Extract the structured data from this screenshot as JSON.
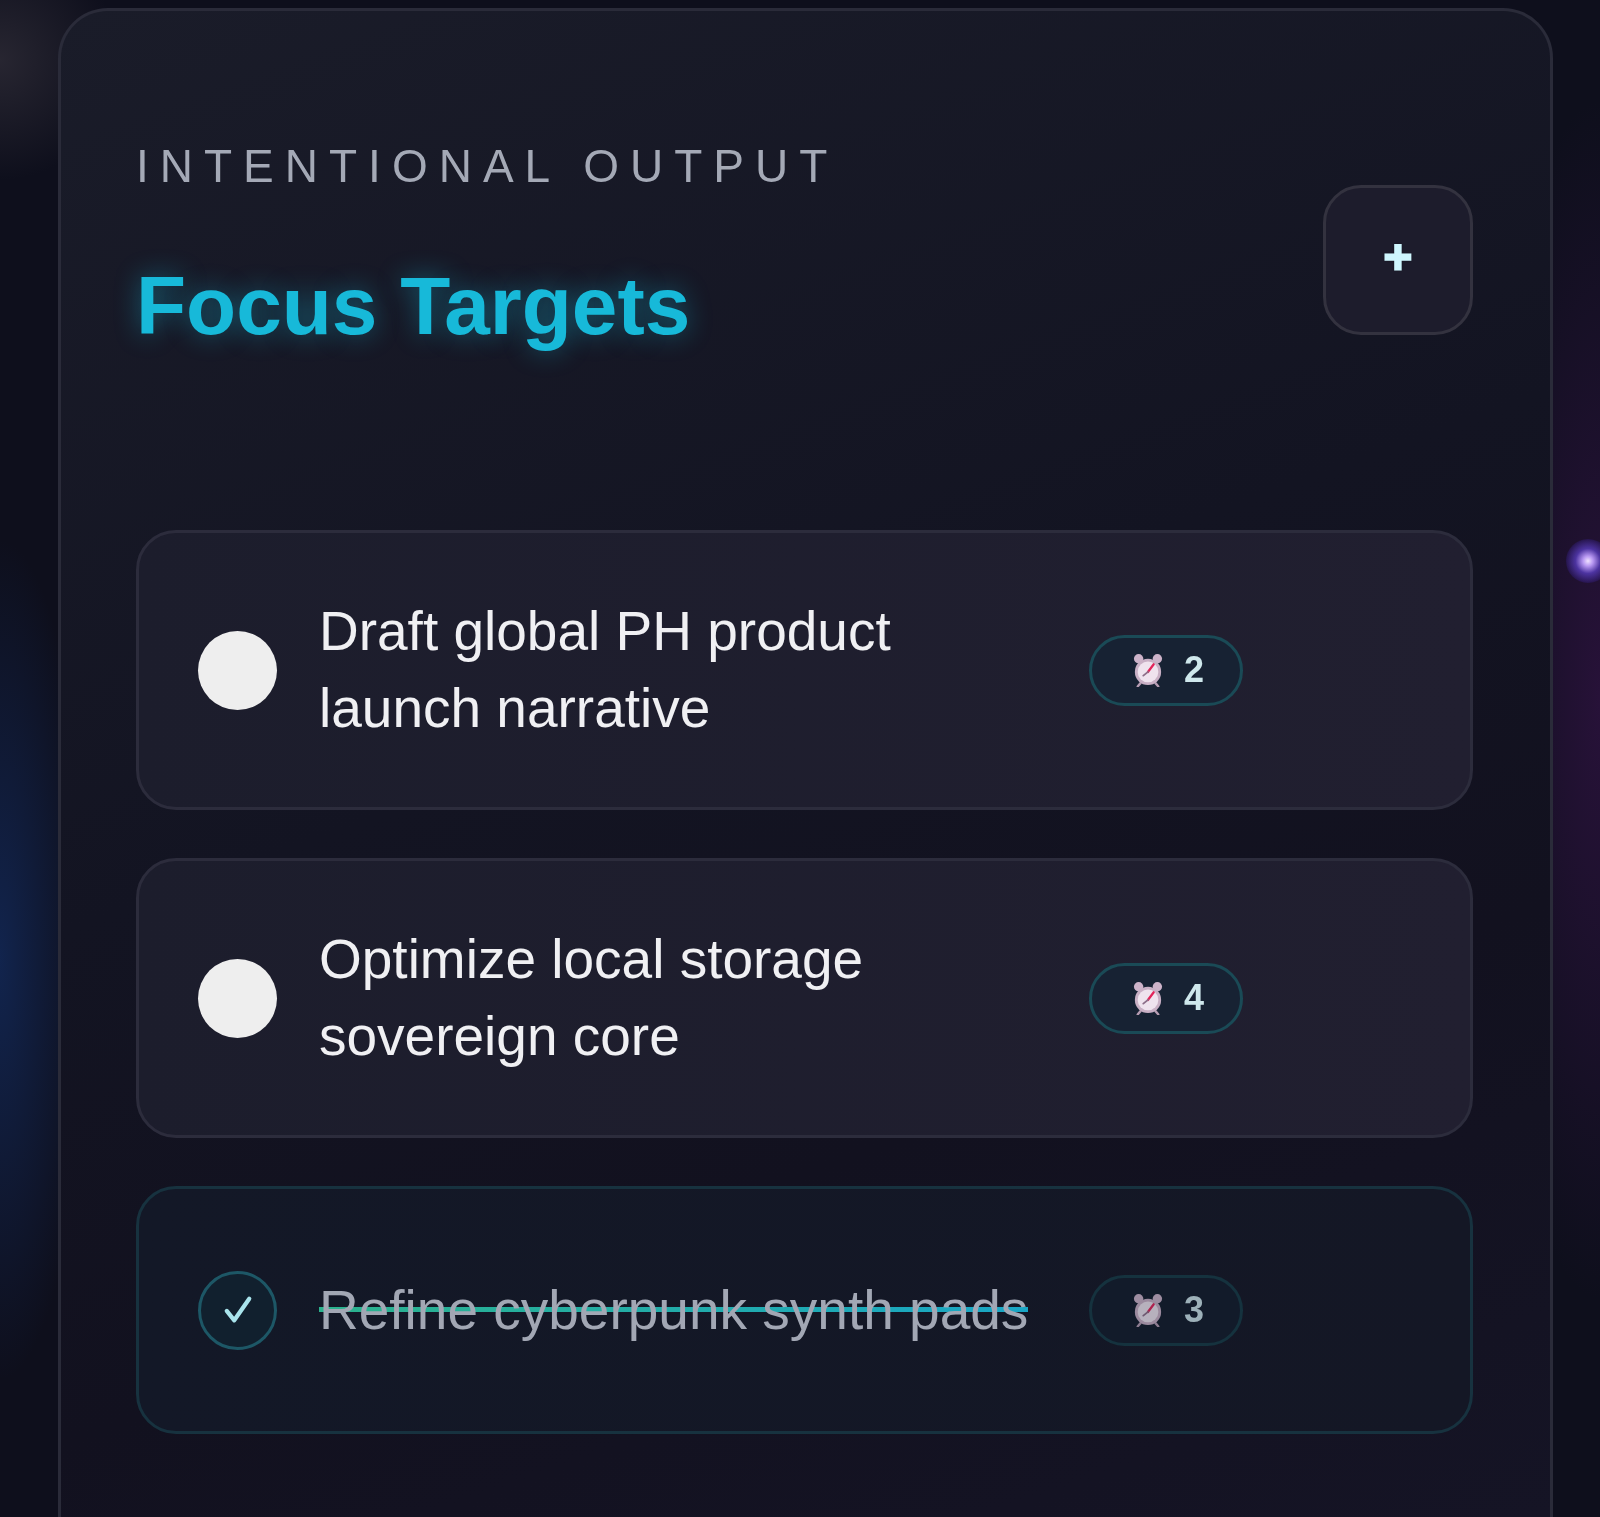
{
  "section_label": "INTENTIONAL OUTPUT",
  "title": "Focus Targets",
  "add_button": {
    "label": "+"
  },
  "tasks": [
    {
      "title": "Draft global PH product launch narrative",
      "done": false,
      "badge": "2"
    },
    {
      "title": "Optimize local storage sovereign core",
      "done": false,
      "badge": "4"
    },
    {
      "title": "Refine cyberpunk synth pads",
      "done": true,
      "badge": "3"
    }
  ]
}
